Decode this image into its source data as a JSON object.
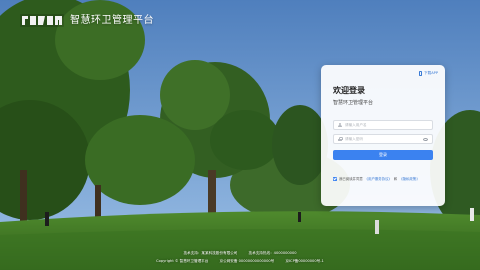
{
  "brand": {
    "title": "智慧环卫管理平台",
    "logo_icon": "brand-logo-icon"
  },
  "card": {
    "download_label": "下载APP",
    "welcome": "欢迎登录",
    "subtitle": "智慧环卫管理平台",
    "username_placeholder": "请输入用户名",
    "password_placeholder": "请输入密码",
    "login_label": "登录",
    "remember_prefix": "我已阅读并同意",
    "user_agreement": "《用户服务协议》",
    "and_text": "和",
    "privacy_policy": "《隐私政策》"
  },
  "footer": {
    "line1": [
      "技术支持：某某科技股份有限公司",
      "技术支持热线：4000000000"
    ],
    "line2": [
      "Copyright © 智慧环卫管理平台",
      "京公网安备 00000000000000号",
      "京ICP备00000000号-1"
    ]
  },
  "colors": {
    "accent": "#3b82f0",
    "link": "#3a7bd5"
  }
}
